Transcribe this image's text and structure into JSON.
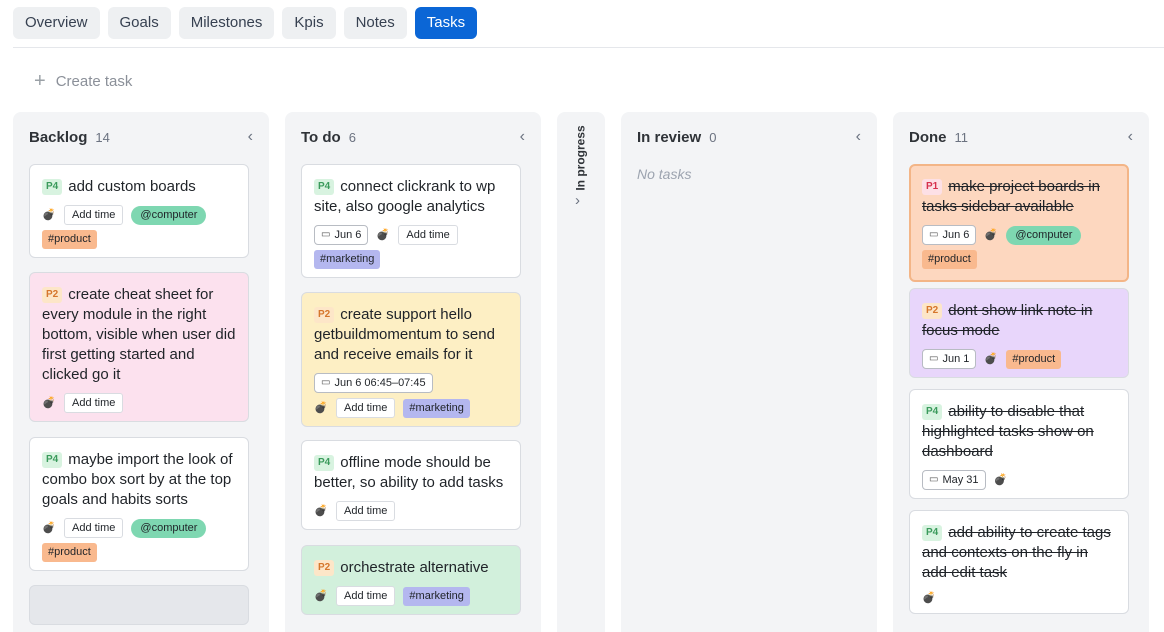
{
  "tabs": [
    "Overview",
    "Goals",
    "Milestones",
    "Kpis",
    "Notes",
    "Tasks"
  ],
  "active_tab": "Tasks",
  "create_task_label": "Create task",
  "icons": {
    "collapse": "chevron-left-icon",
    "expand": "chevron-right-icon",
    "plus": "plus-icon",
    "calendar": "calendar-icon",
    "bomb": "bomb-icon"
  },
  "colors": {
    "accent": "#0b66d6",
    "p4": "#3a9a5b",
    "p2": "#d6762c",
    "p1": "#d6304d",
    "product_tag": "#f9b98e",
    "marketing_tag": "#b4b7ef",
    "context_tag": "#7ed7b1"
  },
  "columns": {
    "backlog": {
      "title": "Backlog",
      "count": "14",
      "cards": [
        {
          "priority": "P4",
          "text": "add custom boards",
          "add_time": "Add time",
          "context": "@computer",
          "tag": "#product"
        },
        {
          "priority": "P2",
          "text": "create cheat sheet for every module in the right bottom, visible when user did first getting started and clicked go it",
          "add_time": "Add time"
        },
        {
          "priority": "P4",
          "text": "maybe import the look of combo box sort by at the top goals and habits sorts",
          "add_time": "Add time",
          "context": "@computer",
          "tag": "#product"
        }
      ]
    },
    "todo": {
      "title": "To do",
      "count": "6",
      "cards": [
        {
          "priority": "P4",
          "text": "connect clickrank to wp site, also google analytics",
          "date": "Jun 6",
          "add_time": "Add time",
          "tag": "#marketing"
        },
        {
          "priority": "P2",
          "text": "create support hello getbuildmomentum to send and receive emails for it",
          "date": "Jun 6 06:45–07:45",
          "add_time": "Add time",
          "tag": "#marketing"
        },
        {
          "priority": "P4",
          "text": "offline mode should be better, so ability to add tasks",
          "add_time": "Add time"
        },
        {
          "priority": "P2",
          "text": "orchestrate alternative",
          "add_time": "Add time",
          "tag": "#marketing"
        }
      ]
    },
    "in_progress": {
      "title": "In progress"
    },
    "in_review": {
      "title": "In review",
      "count": "0",
      "empty": "No tasks"
    },
    "done": {
      "title": "Done",
      "count": "11",
      "cards": [
        {
          "priority": "P1",
          "text": "make project boards in tasks sidebar available",
          "date": "Jun 6",
          "context": "@computer",
          "tag": "#product"
        },
        {
          "priority": "P2",
          "text": "dont show link note in focus mode",
          "date": "Jun 1",
          "tag": "#product"
        },
        {
          "priority": "P4",
          "text": "ability to disable that highlighted tasks show on dashboard",
          "date": "May 31"
        },
        {
          "priority": "P4",
          "text": "add ability to create tags and contexts on the fly in add edit task"
        }
      ]
    }
  }
}
